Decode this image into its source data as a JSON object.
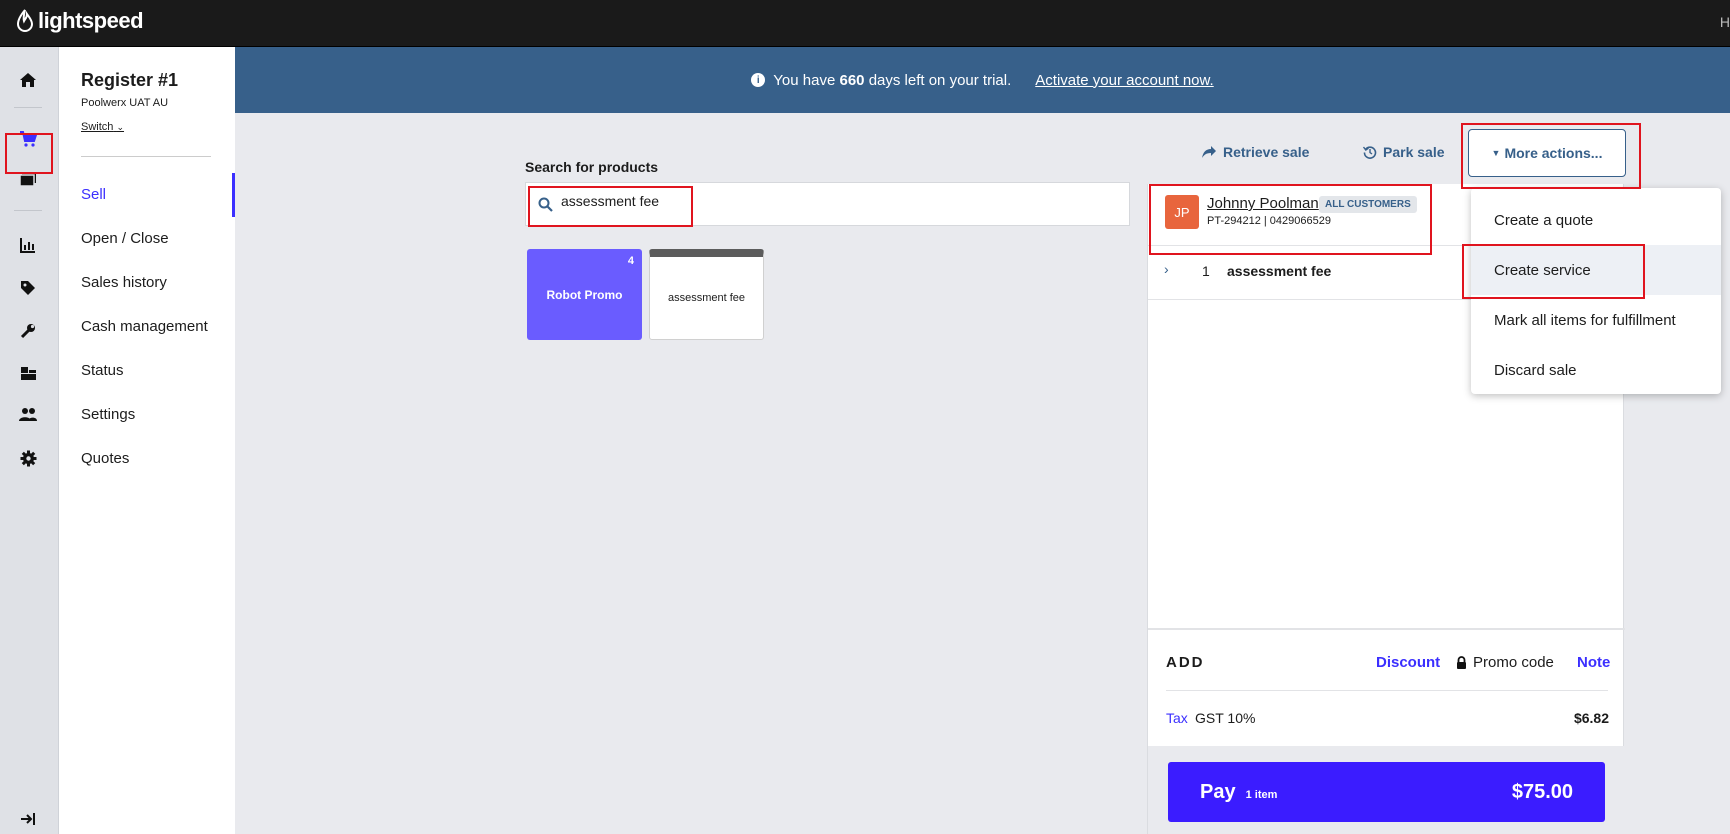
{
  "app": {
    "brand": "lightspeed",
    "topbar_right_text": "H"
  },
  "register": {
    "title": "Register #1",
    "outlet": "Poolwerx UAT AU",
    "switch_label": "Switch"
  },
  "nav": {
    "items": [
      {
        "label": "Sell",
        "active": true
      },
      {
        "label": "Open / Close"
      },
      {
        "label": "Sales history"
      },
      {
        "label": "Cash management"
      },
      {
        "label": "Status"
      },
      {
        "label": "Settings"
      },
      {
        "label": "Quotes"
      }
    ]
  },
  "rail_icons": [
    "home-icon",
    "cart-icon",
    "catalog-icon",
    "reports-icon",
    "tag-icon",
    "wrench-icon",
    "inventory-icon",
    "customers-icon",
    "settings-icon",
    "expand-icon"
  ],
  "trial": {
    "prefix": "You have",
    "days": "660",
    "suffix": "days left on your trial.",
    "activate_label": "Activate your account now."
  },
  "search": {
    "label": "Search for products",
    "value": "assessment fee"
  },
  "tiles": [
    {
      "label": "Robot Promo",
      "count": "4",
      "color": "#6a5cff"
    },
    {
      "label": "assessment fee",
      "color": "#ffffff"
    }
  ],
  "actions": {
    "retrieve_label": "Retrieve sale",
    "park_label": "Park sale",
    "more_label": "More actions..."
  },
  "dropdown": {
    "items": [
      "Create a quote",
      "Create service",
      "Mark all items for fulfillment",
      "Discard sale"
    ],
    "hovered_index": 1
  },
  "sale": {
    "customer": {
      "initials": "JP",
      "name": "Johnny Poolman",
      "group": "ALL CUSTOMERS",
      "detail": "PT-294212 | 0429066529"
    },
    "line_items": [
      {
        "qty": "1",
        "name": "assessment fee"
      }
    ],
    "add": {
      "title": "ADD",
      "discount_label": "Discount",
      "promo_label": "Promo code",
      "note_label": "Note"
    },
    "tax": {
      "label": "Tax",
      "desc": "GST 10%",
      "value": "$6.82"
    },
    "pay": {
      "label": "Pay",
      "count": "1 item",
      "total": "$75.00"
    }
  },
  "colors": {
    "accent": "#3b2fff",
    "trial_bar": "#37608a",
    "topbar": "#1a1a1a",
    "highlight": "#e0141e"
  }
}
